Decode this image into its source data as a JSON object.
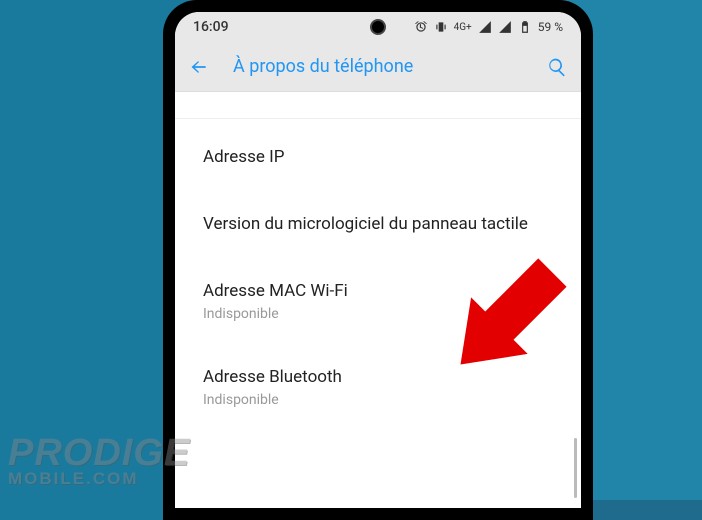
{
  "status": {
    "time": "16:09",
    "network_type": "4G+",
    "battery_text": "59 %"
  },
  "header": {
    "title": "À propos du téléphone"
  },
  "settings": [
    {
      "title": "Adresse IP",
      "subtitle": ""
    },
    {
      "title": "Version du micrologiciel du panneau tactile",
      "subtitle": ""
    },
    {
      "title": "Adresse MAC Wi-Fi",
      "subtitle": "Indisponible"
    },
    {
      "title": "Adresse Bluetooth",
      "subtitle": "Indisponible"
    }
  ],
  "watermark": {
    "line1": "PRODIGE",
    "line2": "MOBILE.COM"
  }
}
